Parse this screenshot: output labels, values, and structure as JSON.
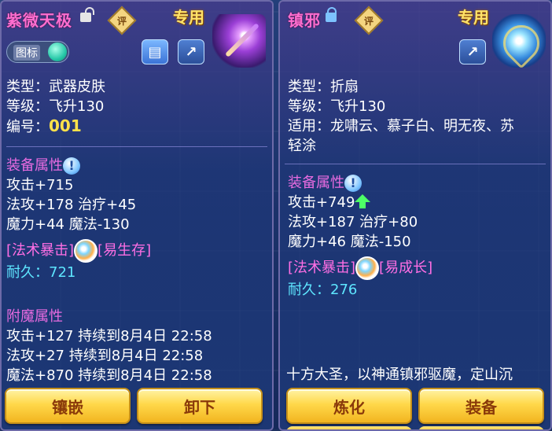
{
  "left": {
    "name": "紫微天极",
    "ping": "评",
    "exclusive": "专用",
    "toggle_label": "图标",
    "type": "类型：武器皮肤",
    "level": "等级：飞升130",
    "id_label": "编号：",
    "id_value": "001",
    "equip_title": "装备属性",
    "attr1": "攻击+715",
    "attr2": "法攻+178 治疗+45",
    "attr3": "魔力+44 魔法-130",
    "skill_left": "[法术暴击]",
    "skill_right": "[易生存]",
    "durability_label": "耐久：",
    "durability_value": "721",
    "enchant_title": "附魔属性",
    "enchant1": "攻击+127 持续到8月4日 22:58",
    "enchant2": "法攻+27 持续到8月4日 22:58",
    "enchant3": "魔法+870 持续到8月4日 22:58",
    "btn_inlay": "镶嵌",
    "btn_remove": "卸下"
  },
  "right": {
    "name": "镇邪",
    "ping": "评",
    "exclusive": "专用",
    "type": "类型：折扇",
    "level": "等级：飞升130",
    "fit_line1": "适用：龙啸云、慕子白、明无夜、苏",
    "fit_line2": "轻涂",
    "equip_title": "装备属性",
    "attr1": "攻击+749",
    "attr2": "法攻+187 治疗+80",
    "attr3": "魔力+46 魔法-150",
    "skill_left": "[法术暴击]",
    "skill_right": "[易成长]",
    "durability_label": "耐久：",
    "durability_value": "276",
    "desc": "十方大圣，以神通镇邪驱魔，定山沉",
    "btn_refine": "炼化",
    "btn_equip": "装备"
  },
  "colors": {
    "name": "#ff6ed0",
    "exclusive": "#ffe36a",
    "id_value": "#ffe24a",
    "section_title": "#e76be0",
    "durability": "#5ee6ff",
    "button_text": "#8a3a0a"
  },
  "icons": {
    "left_lock": "unlocked-lock-icon",
    "right_lock": "locked-lock-icon",
    "help": "info-icon",
    "up": "green-up-arrow-icon",
    "share": "share-icon",
    "book": "book-icon"
  }
}
